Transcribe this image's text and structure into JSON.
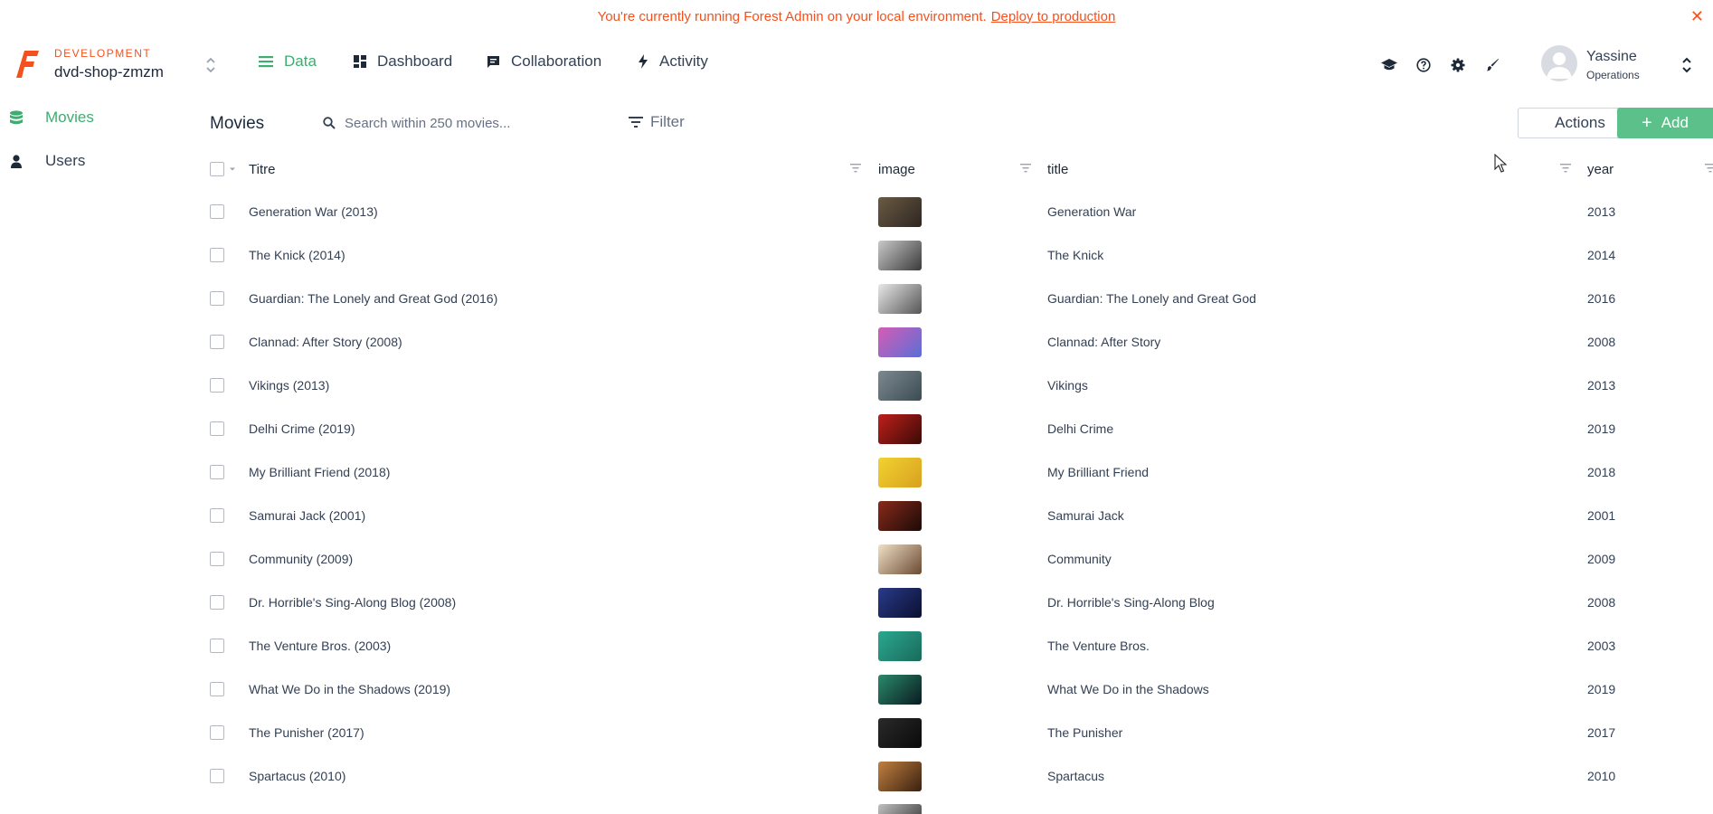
{
  "banner": {
    "text": "You're currently running Forest Admin on your local environment.",
    "link": "Deploy to production",
    "close": "✕"
  },
  "header": {
    "environment": "DEVELOPMENT",
    "project": "dvd-shop-zmzm",
    "nav": [
      {
        "label": "Data",
        "active": true,
        "icon": "data-icon"
      },
      {
        "label": "Dashboard",
        "active": false,
        "icon": "dashboard-icon"
      },
      {
        "label": "Collaboration",
        "active": false,
        "icon": "collaboration-icon"
      },
      {
        "label": "Activity",
        "active": false,
        "icon": "activity-icon"
      }
    ],
    "icons": [
      "graduation-cap-icon",
      "help-icon",
      "gear-icon",
      "brush-icon"
    ],
    "user": {
      "name": "Yassine",
      "role": "Operations"
    }
  },
  "sidebar": {
    "items": [
      {
        "label": "Movies",
        "active": true,
        "icon": "database-icon"
      },
      {
        "label": "Users",
        "active": false,
        "icon": "user-icon"
      }
    ]
  },
  "toolbar": {
    "collection": "Movies",
    "search_placeholder": "Search within 250 movies...",
    "filter_label": "Filter",
    "actions_label": "Actions",
    "add_label": "Add"
  },
  "table": {
    "columns": [
      "Titre",
      "image",
      "title",
      "year"
    ],
    "rows": [
      {
        "titre": "Generation War (2013)",
        "title": "Generation War",
        "year": "2013",
        "thumb": [
          "#6b5a44",
          "#2d2620"
        ]
      },
      {
        "titre": "The Knick (2014)",
        "title": "The Knick",
        "year": "2014",
        "thumb": [
          "#c9c9c9",
          "#3a3a3a"
        ]
      },
      {
        "titre": "Guardian: The Lonely and Great God (2016)",
        "title": "Guardian: The Lonely and Great God",
        "year": "2016",
        "thumb": [
          "#e8e8e8",
          "#555555"
        ]
      },
      {
        "titre": "Clannad: After Story (2008)",
        "title": "Clannad: After Story",
        "year": "2008",
        "thumb": [
          "#d65cb5",
          "#5a6fd6"
        ]
      },
      {
        "titre": "Vikings (2013)",
        "title": "Vikings",
        "year": "2013",
        "thumb": [
          "#7c8a90",
          "#3c4a52"
        ]
      },
      {
        "titre": "Delhi Crime (2019)",
        "title": "Delhi Crime",
        "year": "2019",
        "thumb": [
          "#c0201a",
          "#3a0a08"
        ]
      },
      {
        "titre": "My Brilliant Friend (2018)",
        "title": "My Brilliant Friend",
        "year": "2018",
        "thumb": [
          "#f2d230",
          "#d8a020"
        ]
      },
      {
        "titre": "Samurai Jack (2001)",
        "title": "Samurai Jack",
        "year": "2001",
        "thumb": [
          "#8a2a1a",
          "#1a0a08"
        ]
      },
      {
        "titre": "Community (2009)",
        "title": "Community",
        "year": "2009",
        "thumb": [
          "#f0e0c8",
          "#6a4a30"
        ]
      },
      {
        "titre": "Dr. Horrible's Sing-Along Blog (2008)",
        "title": "Dr. Horrible's Sing-Along Blog",
        "year": "2008",
        "thumb": [
          "#2a3a8a",
          "#0a1030"
        ]
      },
      {
        "titre": "The Venture Bros. (2003)",
        "title": "The Venture Bros.",
        "year": "2003",
        "thumb": [
          "#2aa890",
          "#1a6a5a"
        ]
      },
      {
        "titre": "What We Do in the Shadows (2019)",
        "title": "What We Do in the Shadows",
        "year": "2019",
        "thumb": [
          "#2a8a6a",
          "#0a1a20"
        ]
      },
      {
        "titre": "The Punisher (2017)",
        "title": "The Punisher",
        "year": "2017",
        "thumb": [
          "#2a2a2a",
          "#0a0a0a"
        ]
      },
      {
        "titre": "Spartacus (2010)",
        "title": "Spartacus",
        "year": "2010",
        "thumb": [
          "#c08040",
          "#3a2010"
        ]
      }
    ],
    "partial_row_thumb": [
      "#c0c0c0",
      "#2a2a2a"
    ]
  },
  "colors": {
    "brand_orange": "#f4511e",
    "accent_green": "#3dae6f",
    "add_button": "#5cc08a"
  }
}
